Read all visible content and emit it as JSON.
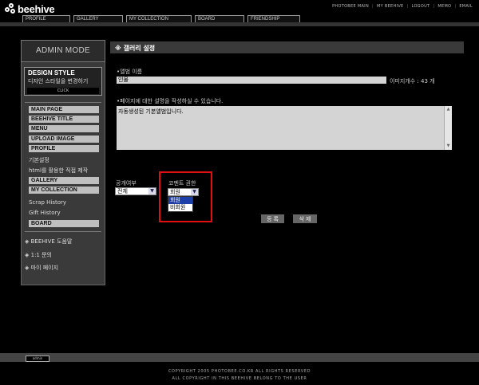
{
  "brand": {
    "logo_text": "beehive"
  },
  "top_links": [
    "PHOTOBEE MAIN",
    "MY BEEHIVE",
    "LOGOUT",
    "MEMO",
    "EMAIL"
  ],
  "nav_tabs": [
    "PROFILE",
    "GALLERY",
    "MY COLLECTION",
    "BOARD",
    "FRIENDSHIP"
  ],
  "sidebar": {
    "header": "ADMIN MODE",
    "design_title": "DESIGN STYLE",
    "design_subtitle": "디자인 스타일을 변경하기",
    "design_click": "CLICK",
    "menu_buttons": [
      "MAIN PAGE",
      "BEEHIVE TITLE",
      "MENU",
      "UPLOAD IMAGE",
      "PROFILE",
      "GALLERY",
      "MY COLLECTION",
      "BOARD"
    ],
    "profile_links": [
      "기본설정",
      "html를 활용한 직접 제작"
    ],
    "collection_links": [
      "Scrap History",
      "Gift History"
    ],
    "bottom_links": [
      "BEEHIVE 도움말",
      "1:1 문의",
      "마이 페이지"
    ],
    "bullet_glyph": "◈"
  },
  "main": {
    "title": "갤러리 설정",
    "title_bullet": "※",
    "album_label": "•앨범 이름",
    "album_value": "인물",
    "image_count": "이미지개수 : 43 개",
    "desc_label": "•페이지에 대한 설명을 작성하실 수 있습니다.",
    "desc_value": "자동생성된 기본앨범입니다.",
    "public_label": "공개여부",
    "public_value": "전체",
    "comment_label": "코멘트 권한",
    "comment_value": "회원",
    "comment_options": [
      "회원",
      "비회원"
    ],
    "register_button": "등 록",
    "delete_button": "삭 제"
  },
  "footer": {
    "button": "admin",
    "copyright1": "COPYRIGHT 2005 PHOTOBEE.CO.KR ALL RIGHTS RESERVED",
    "copyright2": "ALL COPYRIGHT IN THIS BEEHIVE BELONG TO THE USER"
  }
}
